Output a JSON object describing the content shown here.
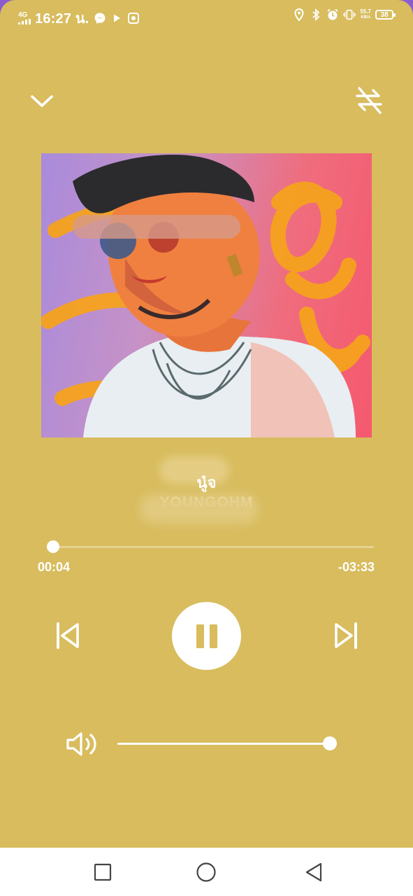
{
  "status_bar": {
    "network": "4G",
    "time": "16:27 น.",
    "speed_value": "55.7",
    "speed_unit": "KB/s",
    "battery": "38"
  },
  "header": {
    "collapse_icon": "chevron-down-icon",
    "repeat_icon": "repeat-off-icon"
  },
  "song": {
    "title": "นู๋จ",
    "artist": "YOUNGOHM"
  },
  "progress": {
    "elapsed": "00:04",
    "remaining": "-03:33",
    "fraction": 0.02
  },
  "controls": {
    "previous_icon": "skip-previous-icon",
    "play_pause_icon": "pause-icon",
    "next_icon": "skip-next-icon"
  },
  "volume": {
    "icon": "volume-icon",
    "level": 1.0
  },
  "nav_bar": {
    "recents_icon": "square-icon",
    "home_icon": "circle-icon",
    "back_icon": "triangle-back-icon"
  },
  "colors": {
    "background": "#d8bc5e",
    "accent": "#ffffff"
  }
}
